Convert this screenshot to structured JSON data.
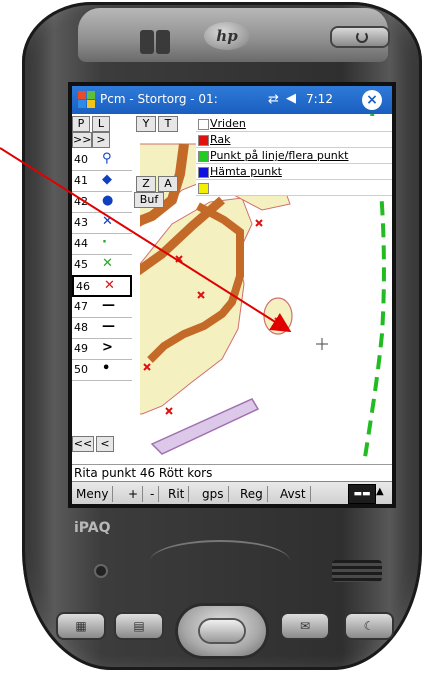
{
  "brand": {
    "hp": "hp",
    "model": "iPAQ"
  },
  "titlebar": {
    "title": "Pcm - Stortorg - 01:",
    "clock": "7:12",
    "close": "×"
  },
  "toolbar": {
    "row1": [
      "P",
      "L",
      "Y",
      "T"
    ],
    "row2": [
      ">>",
      ">"
    ],
    "mid": [
      "Z",
      "A"
    ],
    "buf": "Buf",
    "nav": [
      "<<",
      "<"
    ]
  },
  "points": [
    {
      "num": "40",
      "sym": "⚲"
    },
    {
      "num": "41",
      "sym": "◆"
    },
    {
      "num": "42",
      "sym": "●"
    },
    {
      "num": "43",
      "sym": "✕"
    },
    {
      "num": "44",
      "sym": "·"
    },
    {
      "num": "45",
      "sym": "✕"
    },
    {
      "num": "46",
      "sym": "✕"
    },
    {
      "num": "47",
      "sym": "—"
    },
    {
      "num": "48",
      "sym": "—"
    },
    {
      "num": "49",
      "sym": ">"
    },
    {
      "num": "50",
      "sym": "•"
    }
  ],
  "legend": [
    {
      "label": "Vriden",
      "color": "#ffffff"
    },
    {
      "label": "Rak",
      "color": "#e01010"
    },
    {
      "label": "Punkt på linje/flera punkt",
      "color": "#22cc22"
    },
    {
      "label": "Hämta punkt",
      "color": "#1010e0"
    },
    {
      "label": "",
      "color": "#f0f000"
    }
  ],
  "status": "Rita punkt 46 Rött kors",
  "menu": [
    "Meny",
    "+",
    "-",
    "Rit",
    "gps",
    "Reg",
    "Avst"
  ],
  "colors": {
    "titlebar": "#1a5fc0",
    "area_fill": "#f5f0c0",
    "area_edge": "#d07070",
    "path": "#c46a28",
    "arrow": "#e00000",
    "green_edge": "#22bb22",
    "purple": "#a070b0"
  }
}
